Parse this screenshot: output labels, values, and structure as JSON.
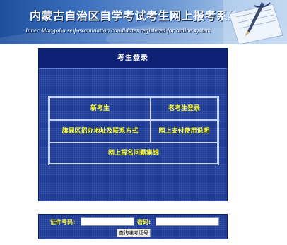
{
  "header": {
    "title": "内蒙古自治区自学考试考生网上报考系统",
    "subtitle": "Inner Mongolia self-examination candidates registered for online system",
    "decoration_icon": "pen-and-paper-icon"
  },
  "login_panel": {
    "title": "考生登录",
    "menu": [
      {
        "label": "新考生"
      },
      {
        "label": "老考生登录"
      },
      {
        "label": "旗县区招办地址及联系方式"
      },
      {
        "label": "网上支付使用说明"
      },
      {
        "label": "网上报名问题集锦"
      }
    ]
  },
  "query_bar": {
    "id_label": "证件号码:",
    "id_value": "",
    "password_label": "密码:",
    "password_value": "",
    "button_label": "查询准考证号"
  },
  "colors": {
    "panel_background": "#1c3a96",
    "panel_header": "#0d2274",
    "menu_text": "#ffff33",
    "banner_start": "#1d4f9c",
    "banner_end": "#bcd4ee"
  }
}
